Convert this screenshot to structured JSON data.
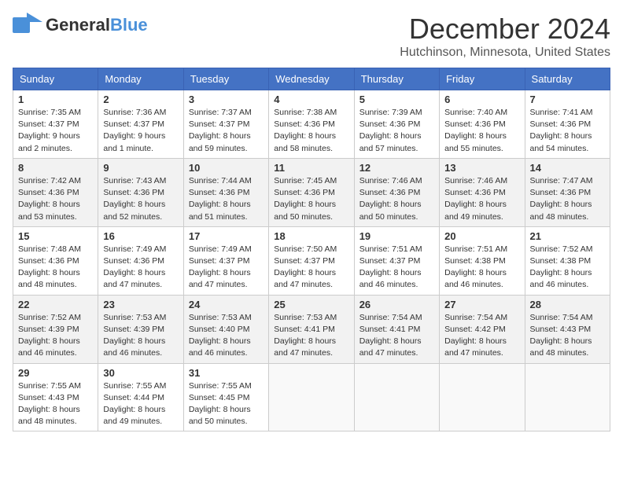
{
  "header": {
    "logo_general": "General",
    "logo_blue": "Blue",
    "month": "December 2024",
    "location": "Hutchinson, Minnesota, United States"
  },
  "days_of_week": [
    "Sunday",
    "Monday",
    "Tuesday",
    "Wednesday",
    "Thursday",
    "Friday",
    "Saturday"
  ],
  "weeks": [
    [
      {
        "day": "1",
        "sunrise": "Sunrise: 7:35 AM",
        "sunset": "Sunset: 4:37 PM",
        "daylight": "Daylight: 9 hours and 2 minutes."
      },
      {
        "day": "2",
        "sunrise": "Sunrise: 7:36 AM",
        "sunset": "Sunset: 4:37 PM",
        "daylight": "Daylight: 9 hours and 1 minute."
      },
      {
        "day": "3",
        "sunrise": "Sunrise: 7:37 AM",
        "sunset": "Sunset: 4:37 PM",
        "daylight": "Daylight: 8 hours and 59 minutes."
      },
      {
        "day": "4",
        "sunrise": "Sunrise: 7:38 AM",
        "sunset": "Sunset: 4:36 PM",
        "daylight": "Daylight: 8 hours and 58 minutes."
      },
      {
        "day": "5",
        "sunrise": "Sunrise: 7:39 AM",
        "sunset": "Sunset: 4:36 PM",
        "daylight": "Daylight: 8 hours and 57 minutes."
      },
      {
        "day": "6",
        "sunrise": "Sunrise: 7:40 AM",
        "sunset": "Sunset: 4:36 PM",
        "daylight": "Daylight: 8 hours and 55 minutes."
      },
      {
        "day": "7",
        "sunrise": "Sunrise: 7:41 AM",
        "sunset": "Sunset: 4:36 PM",
        "daylight": "Daylight: 8 hours and 54 minutes."
      }
    ],
    [
      {
        "day": "8",
        "sunrise": "Sunrise: 7:42 AM",
        "sunset": "Sunset: 4:36 PM",
        "daylight": "Daylight: 8 hours and 53 minutes."
      },
      {
        "day": "9",
        "sunrise": "Sunrise: 7:43 AM",
        "sunset": "Sunset: 4:36 PM",
        "daylight": "Daylight: 8 hours and 52 minutes."
      },
      {
        "day": "10",
        "sunrise": "Sunrise: 7:44 AM",
        "sunset": "Sunset: 4:36 PM",
        "daylight": "Daylight: 8 hours and 51 minutes."
      },
      {
        "day": "11",
        "sunrise": "Sunrise: 7:45 AM",
        "sunset": "Sunset: 4:36 PM",
        "daylight": "Daylight: 8 hours and 50 minutes."
      },
      {
        "day": "12",
        "sunrise": "Sunrise: 7:46 AM",
        "sunset": "Sunset: 4:36 PM",
        "daylight": "Daylight: 8 hours and 50 minutes."
      },
      {
        "day": "13",
        "sunrise": "Sunrise: 7:46 AM",
        "sunset": "Sunset: 4:36 PM",
        "daylight": "Daylight: 8 hours and 49 minutes."
      },
      {
        "day": "14",
        "sunrise": "Sunrise: 7:47 AM",
        "sunset": "Sunset: 4:36 PM",
        "daylight": "Daylight: 8 hours and 48 minutes."
      }
    ],
    [
      {
        "day": "15",
        "sunrise": "Sunrise: 7:48 AM",
        "sunset": "Sunset: 4:36 PM",
        "daylight": "Daylight: 8 hours and 48 minutes."
      },
      {
        "day": "16",
        "sunrise": "Sunrise: 7:49 AM",
        "sunset": "Sunset: 4:36 PM",
        "daylight": "Daylight: 8 hours and 47 minutes."
      },
      {
        "day": "17",
        "sunrise": "Sunrise: 7:49 AM",
        "sunset": "Sunset: 4:37 PM",
        "daylight": "Daylight: 8 hours and 47 minutes."
      },
      {
        "day": "18",
        "sunrise": "Sunrise: 7:50 AM",
        "sunset": "Sunset: 4:37 PM",
        "daylight": "Daylight: 8 hours and 47 minutes."
      },
      {
        "day": "19",
        "sunrise": "Sunrise: 7:51 AM",
        "sunset": "Sunset: 4:37 PM",
        "daylight": "Daylight: 8 hours and 46 minutes."
      },
      {
        "day": "20",
        "sunrise": "Sunrise: 7:51 AM",
        "sunset": "Sunset: 4:38 PM",
        "daylight": "Daylight: 8 hours and 46 minutes."
      },
      {
        "day": "21",
        "sunrise": "Sunrise: 7:52 AM",
        "sunset": "Sunset: 4:38 PM",
        "daylight": "Daylight: 8 hours and 46 minutes."
      }
    ],
    [
      {
        "day": "22",
        "sunrise": "Sunrise: 7:52 AM",
        "sunset": "Sunset: 4:39 PM",
        "daylight": "Daylight: 8 hours and 46 minutes."
      },
      {
        "day": "23",
        "sunrise": "Sunrise: 7:53 AM",
        "sunset": "Sunset: 4:39 PM",
        "daylight": "Daylight: 8 hours and 46 minutes."
      },
      {
        "day": "24",
        "sunrise": "Sunrise: 7:53 AM",
        "sunset": "Sunset: 4:40 PM",
        "daylight": "Daylight: 8 hours and 46 minutes."
      },
      {
        "day": "25",
        "sunrise": "Sunrise: 7:53 AM",
        "sunset": "Sunset: 4:41 PM",
        "daylight": "Daylight: 8 hours and 47 minutes."
      },
      {
        "day": "26",
        "sunrise": "Sunrise: 7:54 AM",
        "sunset": "Sunset: 4:41 PM",
        "daylight": "Daylight: 8 hours and 47 minutes."
      },
      {
        "day": "27",
        "sunrise": "Sunrise: 7:54 AM",
        "sunset": "Sunset: 4:42 PM",
        "daylight": "Daylight: 8 hours and 47 minutes."
      },
      {
        "day": "28",
        "sunrise": "Sunrise: 7:54 AM",
        "sunset": "Sunset: 4:43 PM",
        "daylight": "Daylight: 8 hours and 48 minutes."
      }
    ],
    [
      {
        "day": "29",
        "sunrise": "Sunrise: 7:55 AM",
        "sunset": "Sunset: 4:43 PM",
        "daylight": "Daylight: 8 hours and 48 minutes."
      },
      {
        "day": "30",
        "sunrise": "Sunrise: 7:55 AM",
        "sunset": "Sunset: 4:44 PM",
        "daylight": "Daylight: 8 hours and 49 minutes."
      },
      {
        "day": "31",
        "sunrise": "Sunrise: 7:55 AM",
        "sunset": "Sunset: 4:45 PM",
        "daylight": "Daylight: 8 hours and 50 minutes."
      },
      null,
      null,
      null,
      null
    ]
  ]
}
